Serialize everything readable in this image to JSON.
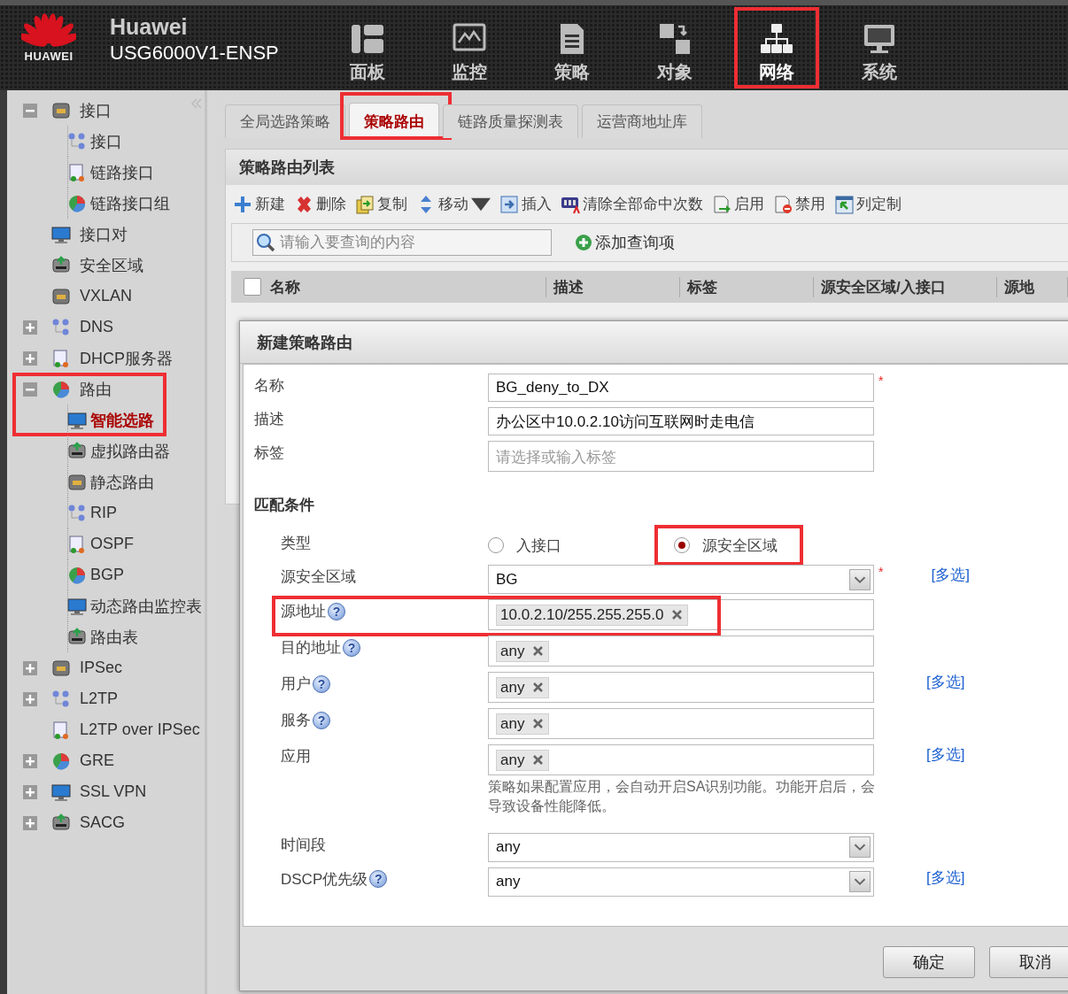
{
  "header": {
    "brand": "HUAWEI",
    "title": "Huawei",
    "device": "USG6000V1-ENSP"
  },
  "nav": [
    {
      "label": "面板",
      "selected": false
    },
    {
      "label": "监控",
      "selected": false
    },
    {
      "label": "策略",
      "selected": false
    },
    {
      "label": "对象",
      "selected": false
    },
    {
      "label": "网络",
      "selected": true,
      "highlighted": true
    },
    {
      "label": "系统",
      "selected": false
    }
  ],
  "sidebar": {
    "items": [
      {
        "label": "接口",
        "expanded": true,
        "selected": false,
        "children": [
          {
            "label": "接口",
            "selected": false
          },
          {
            "label": "链路接口",
            "selected": false
          },
          {
            "label": "链路接口组",
            "selected": false
          }
        ]
      },
      {
        "label": "接口对",
        "selected": false
      },
      {
        "label": "安全区域",
        "selected": false
      },
      {
        "label": "VXLAN",
        "selected": false
      },
      {
        "label": "DNS",
        "expanded": false,
        "selected": false
      },
      {
        "label": "DHCP服务器",
        "expanded": false,
        "selected": false
      },
      {
        "label": "路由",
        "expanded": true,
        "selected": false,
        "highlighted": true,
        "children": [
          {
            "label": "智能选路",
            "selected": true
          },
          {
            "label": "虚拟路由器",
            "selected": false
          },
          {
            "label": "静态路由",
            "selected": false
          },
          {
            "label": "RIP",
            "selected": false
          },
          {
            "label": "OSPF",
            "selected": false
          },
          {
            "label": "BGP",
            "selected": false
          },
          {
            "label": "动态路由监控表",
            "selected": false
          },
          {
            "label": "路由表",
            "selected": false
          }
        ]
      },
      {
        "label": "IPSec",
        "expanded": false,
        "selected": false
      },
      {
        "label": "L2TP",
        "expanded": false,
        "selected": false
      },
      {
        "label": "L2TP over IPSec",
        "selected": false
      },
      {
        "label": "GRE",
        "expanded": false,
        "selected": false
      },
      {
        "label": "SSL VPN",
        "expanded": false,
        "selected": false
      },
      {
        "label": "SACG",
        "expanded": false,
        "selected": false
      }
    ]
  },
  "tabs": [
    {
      "label": "全局选路策略",
      "selected": false
    },
    {
      "label": "策略路由",
      "selected": true,
      "highlighted": true
    },
    {
      "label": "链路质量探测表",
      "selected": false
    },
    {
      "label": "运营商地址库",
      "selected": false
    }
  ],
  "panel": {
    "title": "策略路由列表",
    "toolbar": [
      {
        "label": "新建"
      },
      {
        "label": "删除"
      },
      {
        "label": "复制"
      },
      {
        "label": "移动",
        "dropdown": true
      },
      {
        "label": "插入"
      },
      {
        "label": "清除全部命中次数"
      },
      {
        "label": "启用"
      },
      {
        "label": "禁用"
      },
      {
        "label": "列定制"
      }
    ],
    "search": {
      "placeholder": "请输入要查询的内容"
    },
    "add_query": "添加查询项",
    "select_all": {
      "checked": false
    },
    "columns": [
      "名称",
      "描述",
      "标签",
      "源安全区域/入接口",
      "源地"
    ]
  },
  "dialog": {
    "title": "新建策略路由",
    "fields": [
      {
        "kind": "text",
        "label": "名称",
        "value": "BG_deny_to_DX",
        "required_mark": "*"
      },
      {
        "kind": "text",
        "label": "描述",
        "value": "办公区中10.0.2.10访问互联网时走电信"
      },
      {
        "kind": "tag-input",
        "label": "标签",
        "placeholder": "请选择或输入标签"
      }
    ],
    "section": "匹配条件",
    "conditions": [
      {
        "kind": "radio",
        "label": "类型",
        "options": [
          {
            "label": "入接口",
            "selected": false
          },
          {
            "label": "源安全区域",
            "selected": true,
            "highlighted": true
          }
        ]
      },
      {
        "kind": "select",
        "label": "源安全区域",
        "value": "BG",
        "required_mark": "*",
        "multi_link": "[多选]"
      },
      {
        "kind": "tags",
        "label": "源地址",
        "help": "?",
        "tags": [
          "10.0.2.10/255.255.255.0"
        ],
        "highlighted": true
      },
      {
        "kind": "tags",
        "label": "目的地址",
        "help": "?",
        "tags": [
          "any"
        ]
      },
      {
        "kind": "tags",
        "label": "用户",
        "help": "?",
        "tags": [
          "any"
        ],
        "multi_link": "[多选]"
      },
      {
        "kind": "tags",
        "label": "服务",
        "help": "?",
        "tags": [
          "any"
        ]
      },
      {
        "kind": "tags",
        "label": "应用",
        "tags": [
          "any"
        ],
        "multi_link": "[多选]",
        "note": "策略如果配置应用，会自动开启SA识别功能。功能开启后，会导致设备性能降低。"
      },
      {
        "kind": "select",
        "label": "时间段",
        "value": "any"
      },
      {
        "kind": "select",
        "label": "DSCP优先级",
        "help": "?",
        "value": "any",
        "multi_link": "[多选]"
      }
    ],
    "buttons": [
      "确定",
      "取消"
    ]
  }
}
